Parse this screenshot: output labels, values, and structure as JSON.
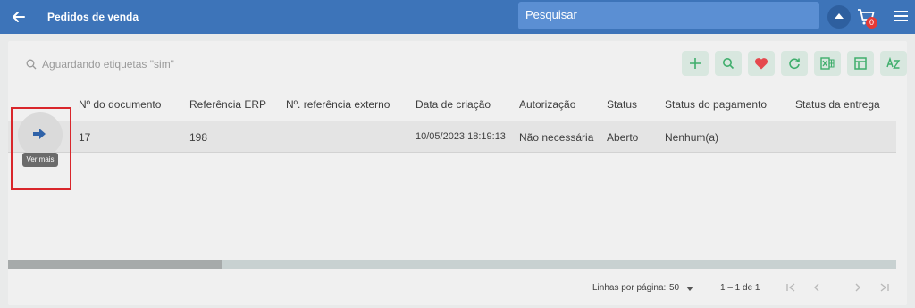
{
  "header": {
    "title": "Pedidos de venda",
    "search_placeholder": "Pesquisar",
    "cart_count": "0"
  },
  "filter": {
    "text": "Aguardando etiquetas \"sim\""
  },
  "toolbar": {
    "buttons": [
      "add-icon",
      "search-icon",
      "favorite-icon",
      "refresh-icon",
      "excel-export-icon",
      "columns-icon",
      "sort-az-icon"
    ]
  },
  "table": {
    "columns": [
      "Nº do documento",
      "Referência ERP",
      "Nº. referência externo",
      "Data de criação",
      "Autorização",
      "Status",
      "Status do pagamento",
      "Status da entrega"
    ],
    "rows": [
      {
        "documento": "17",
        "referencia_erp": "198",
        "referencia_externo": "",
        "data_criacao": "10/05/2023 18:19:13",
        "autorizacao": "Não necessária",
        "status": "Aberto",
        "status_pagamento": "Nenhum(a)",
        "status_entrega": ""
      }
    ]
  },
  "row_action": {
    "tooltip": "Ver mais"
  },
  "pager": {
    "label": "Linhas por página:",
    "page_size": "50",
    "range": "1 – 1 de 1"
  },
  "colors": {
    "header_bg": "#3d74b9",
    "search_bg": "#5b8fd3",
    "toolbar_btn_bg": "#d8e7df",
    "toolbar_icon": "#3fae6c",
    "favorite_icon": "#e5484d",
    "highlight_border": "#d9262b"
  }
}
